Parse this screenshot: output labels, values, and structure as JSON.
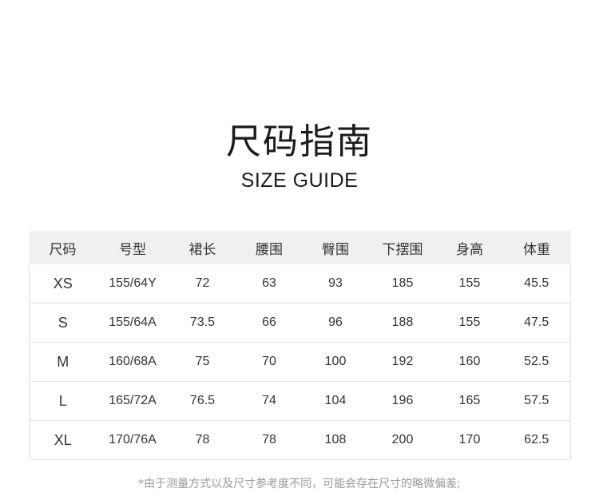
{
  "title_zh": "尺码指南",
  "title_en": "SIZE GUIDE",
  "table": {
    "headers": [
      "尺码",
      "号型",
      "裙长",
      "腰围",
      "臀围",
      "下摆围",
      "身高",
      "体重"
    ],
    "rows": [
      [
        "XS",
        "155/64Y",
        "72",
        "63",
        "93",
        "185",
        "155",
        "45.5"
      ],
      [
        "S",
        "155/64A",
        "73.5",
        "66",
        "96",
        "188",
        "155",
        "47.5"
      ],
      [
        "M",
        "160/68A",
        "75",
        "70",
        "100",
        "192",
        "160",
        "52.5"
      ],
      [
        "L",
        "165/72A",
        "76.5",
        "74",
        "104",
        "196",
        "165",
        "57.5"
      ],
      [
        "XL",
        "170/76A",
        "78",
        "78",
        "108",
        "200",
        "170",
        "62.5"
      ]
    ]
  },
  "footnote": "*由于测量方式以及尺寸参考度不同，可能会存在尺寸的略微偏差;",
  "colors": {
    "header_bg": "#f1eff0",
    "text": "#333333",
    "border": "#e2e2e2",
    "footnote": "#999999"
  }
}
